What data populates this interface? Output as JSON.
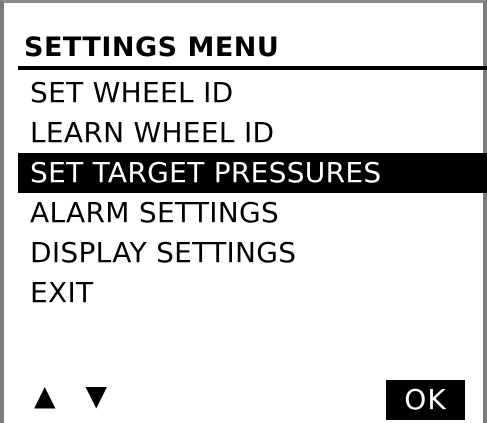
{
  "title": "SETTINGS MENU",
  "menu": {
    "items": [
      {
        "label": "SET WHEEL ID",
        "selected": false
      },
      {
        "label": "LEARN WHEEL ID",
        "selected": false
      },
      {
        "label": "SET TARGET PRESSURES",
        "selected": true
      },
      {
        "label": "ALARM SETTINGS",
        "selected": false
      },
      {
        "label": "DISPLAY SETTINGS",
        "selected": false
      },
      {
        "label": "EXIT",
        "selected": false
      }
    ]
  },
  "nav": {
    "up_icon": "up-arrow-icon",
    "up_glyph": "▲",
    "down_icon": "down-arrow-icon",
    "down_glyph": "▼"
  },
  "ok_label": "OK",
  "colors": {
    "background": "#ffffff",
    "foreground": "#000000",
    "highlight": "#000000",
    "highlight_text": "#ffffff"
  }
}
